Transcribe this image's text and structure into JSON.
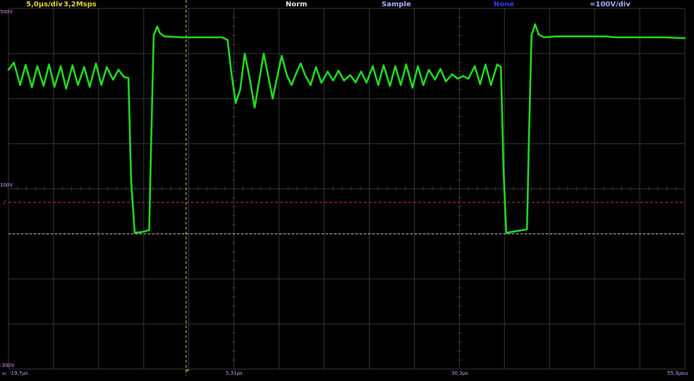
{
  "header": {
    "timebase": "5,0µs/div",
    "sample_rate": "3,2Msps",
    "trigger_mode": "Norm",
    "acquisition": "Sample",
    "math": "None",
    "channel_scale": "=100V/div"
  },
  "colors": {
    "background": "#000000",
    "grid": "#3a3a3a",
    "trace": "#22dd22",
    "trigger_level": "#d23a2a",
    "ground_marker": "#e0e0e0",
    "trigger_time": "#e8d23a",
    "axis_labels": "#d69aff"
  },
  "y_labels": {
    "top": "500V",
    "middle": "100V",
    "bottom": "-300V"
  },
  "x_labels": {
    "left": "-19,7µs",
    "center_left": "5,31µs",
    "center_right": "30,3µs",
    "right": "55,3µs"
  },
  "chart_data": {
    "type": "line",
    "xlabel": "",
    "ylabel": "",
    "xlim": [
      -19.7,
      55.3
    ],
    "ylim": [
      -300,
      500
    ],
    "grid": true,
    "trigger_level_V": 70,
    "ground_level_V": 0,
    "trigger_time_us": 0,
    "series": [
      {
        "points": [
          [
            -19.7,
            364
          ],
          [
            -19.1,
            380
          ],
          [
            -18.4,
            330
          ],
          [
            -17.8,
            375
          ],
          [
            -17.1,
            325
          ],
          [
            -16.5,
            372
          ],
          [
            -15.8,
            328
          ],
          [
            -15.2,
            376
          ],
          [
            -14.6,
            326
          ],
          [
            -13.9,
            372
          ],
          [
            -13.3,
            322
          ],
          [
            -12.6,
            374
          ],
          [
            -12.0,
            330
          ],
          [
            -11.3,
            370
          ],
          [
            -10.7,
            326
          ],
          [
            -10.0,
            378
          ],
          [
            -9.4,
            330
          ],
          [
            -8.8,
            370
          ],
          [
            -8.1,
            342
          ],
          [
            -7.5,
            364
          ],
          [
            -6.9,
            348
          ],
          [
            -6.4,
            346
          ],
          [
            -6.1,
            118
          ],
          [
            -5.7,
            2
          ],
          [
            -4.9,
            4
          ],
          [
            -4.1,
            8
          ],
          [
            -3.9,
            180
          ],
          [
            -3.6,
            440
          ],
          [
            -3.2,
            460
          ],
          [
            -2.9,
            445
          ],
          [
            -2.4,
            438
          ],
          [
            -0.5,
            436
          ],
          [
            1.2,
            436
          ],
          [
            4.0,
            436
          ],
          [
            4.6,
            430
          ],
          [
            5.0,
            360
          ],
          [
            5.5,
            290
          ],
          [
            6.0,
            320
          ],
          [
            6.5,
            400
          ],
          [
            7.0,
            350
          ],
          [
            7.6,
            280
          ],
          [
            8.1,
            340
          ],
          [
            8.6,
            400
          ],
          [
            9.1,
            350
          ],
          [
            9.6,
            300
          ],
          [
            10.1,
            348
          ],
          [
            10.6,
            395
          ],
          [
            11.2,
            350
          ],
          [
            11.7,
            330
          ],
          [
            12.2,
            356
          ],
          [
            12.7,
            378
          ],
          [
            13.2,
            352
          ],
          [
            13.8,
            330
          ],
          [
            14.4,
            370
          ],
          [
            15.0,
            335
          ],
          [
            15.7,
            360
          ],
          [
            16.3,
            340
          ],
          [
            16.9,
            362
          ],
          [
            17.5,
            340
          ],
          [
            18.2,
            352
          ],
          [
            18.8,
            336
          ],
          [
            19.4,
            360
          ],
          [
            20.0,
            335
          ],
          [
            20.7,
            372
          ],
          [
            21.3,
            330
          ],
          [
            21.9,
            374
          ],
          [
            22.6,
            328
          ],
          [
            23.2,
            372
          ],
          [
            23.8,
            330
          ],
          [
            24.4,
            376
          ],
          [
            25.1,
            324
          ],
          [
            25.7,
            372
          ],
          [
            26.3,
            330
          ],
          [
            26.9,
            364
          ],
          [
            27.6,
            342
          ],
          [
            28.2,
            366
          ],
          [
            28.8,
            338
          ],
          [
            29.5,
            354
          ],
          [
            30.1,
            344
          ],
          [
            30.7,
            350
          ],
          [
            31.3,
            344
          ],
          [
            32.0,
            372
          ],
          [
            32.6,
            332
          ],
          [
            33.2,
            376
          ],
          [
            33.8,
            330
          ],
          [
            34.5,
            376
          ],
          [
            34.9,
            370
          ],
          [
            35.2,
            140
          ],
          [
            35.5,
            2
          ],
          [
            36.6,
            6
          ],
          [
            37.8,
            10
          ],
          [
            38.0,
            200
          ],
          [
            38.3,
            440
          ],
          [
            38.7,
            465
          ],
          [
            39.1,
            442
          ],
          [
            39.7,
            436
          ],
          [
            41.0,
            438
          ],
          [
            46.6,
            438
          ],
          [
            47.6,
            436
          ],
          [
            53.0,
            436
          ],
          [
            55.3,
            434
          ]
        ]
      }
    ]
  }
}
